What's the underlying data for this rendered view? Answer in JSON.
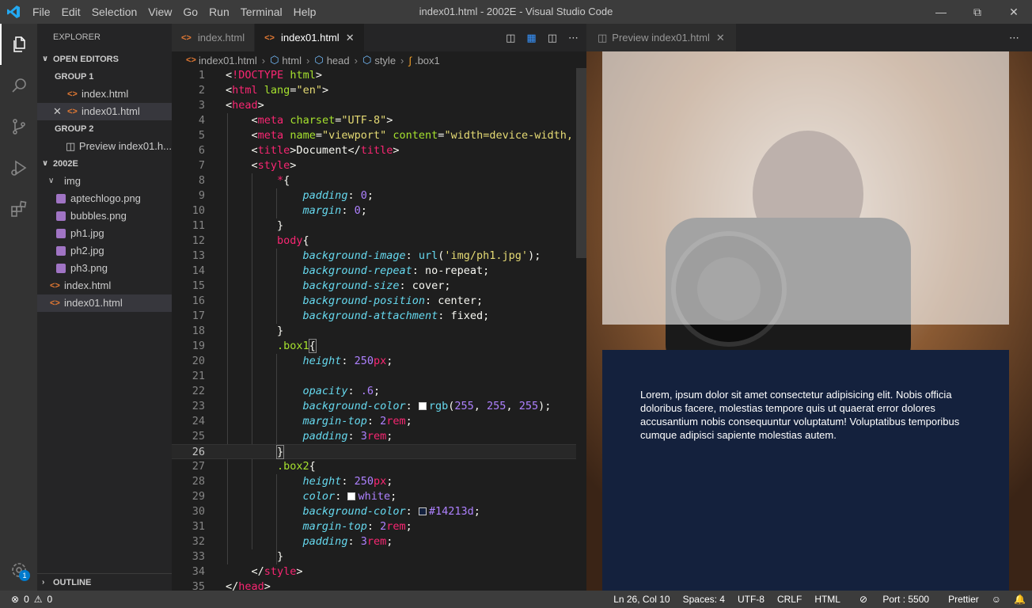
{
  "window": {
    "title": "index01.html - 2002E - Visual Studio Code"
  },
  "menu": [
    "File",
    "Edit",
    "Selection",
    "View",
    "Go",
    "Run",
    "Terminal",
    "Help"
  ],
  "sidebar": {
    "title": "EXPLORER",
    "open_editors": "OPEN EDITORS",
    "group1": "GROUP 1",
    "group1_items": [
      "index.html",
      "index01.html"
    ],
    "group2": "GROUP 2",
    "group2_items": [
      "Preview index01.h..."
    ],
    "folder": "2002E",
    "img_folder": "img",
    "img_files": [
      "aptechlogo.png",
      "bubbles.png",
      "ph1.jpg",
      "ph2.jpg",
      "ph3.png"
    ],
    "files": [
      "index.html",
      "index01.html"
    ],
    "outline": "OUTLINE"
  },
  "tabs": [
    "index.html",
    "index01.html"
  ],
  "breadcrumbs": [
    "index01.html",
    "html",
    "head",
    "style",
    ".box1"
  ],
  "line_numbers": [
    "1",
    "2",
    "3",
    "4",
    "5",
    "6",
    "7",
    "8",
    "9",
    "10",
    "11",
    "12",
    "13",
    "14",
    "15",
    "16",
    "17",
    "18",
    "19",
    "20",
    "21",
    "22",
    "23",
    "24",
    "25",
    "26",
    "27",
    "28",
    "29",
    "30",
    "31",
    "32",
    "33",
    "34",
    "35"
  ],
  "preview": {
    "tab_label": "Preview index01.html",
    "box2_text": "Lorem, ipsum dolor sit amet consectetur adipisicing elit. Nobis officia doloribus facere, molestias tempore quis ut quaerat error dolores accusantium nobis consequuntur voluptatum! Voluptatibus temporibus cumque adipisci sapiente molestias autem."
  },
  "status": {
    "errors": "0",
    "warnings": "0",
    "position": "Ln 26, Col 10",
    "spaces": "Spaces: 4",
    "encoding": "UTF-8",
    "eol": "CRLF",
    "language": "HTML",
    "port": "Port : 5500",
    "formatter": "Prettier"
  },
  "badge": "1",
  "colors": {
    "accent": "#007acc",
    "box2_bg": "#14213d"
  }
}
